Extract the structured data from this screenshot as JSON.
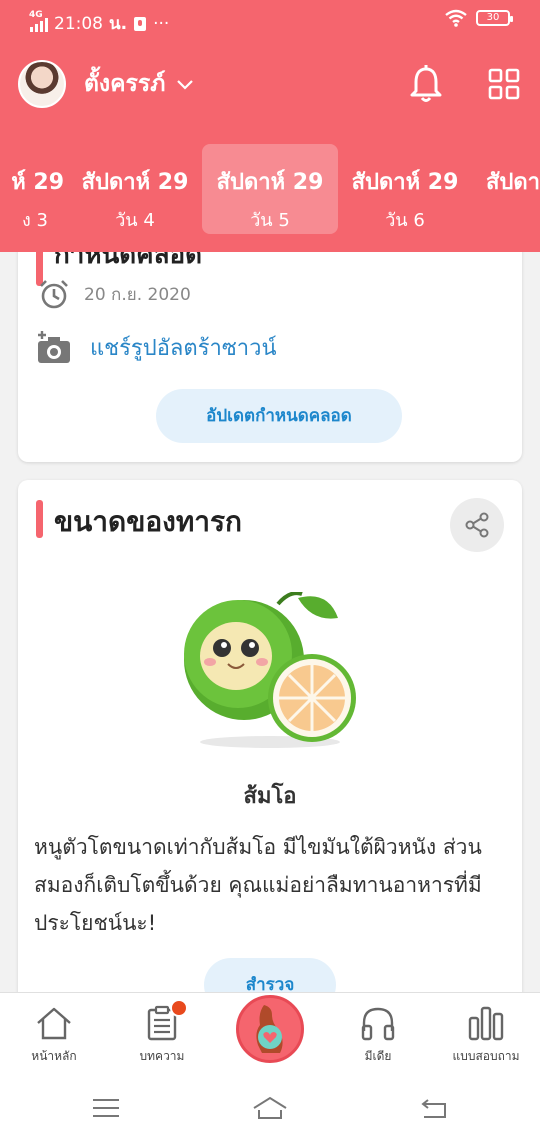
{
  "status_bar": {
    "network": "4G",
    "time": "21:08",
    "icons_text": "น.",
    "more": "···",
    "battery": "30"
  },
  "header": {
    "profile_name": "ตั้งครรภ์",
    "weeks": [
      {
        "title": "ห์ 29",
        "day": "ง 3"
      },
      {
        "title": "สัปดาห์ 29",
        "day": "วัน 4"
      },
      {
        "title": "สัปดาห์ 29",
        "day": "วัน 5"
      },
      {
        "title": "สัปดาห์ 29",
        "day": "วัน 6"
      },
      {
        "title": "สัปดา",
        "day": ""
      }
    ],
    "active_week_index": 2
  },
  "due_card": {
    "title": "กำหนดคลอด",
    "date": "20 ก.ย. 2020",
    "share_ultrasound": "แชร์รูปอัลตร้าซาวน์",
    "update_button": "อัปเดตกำหนดคลอด"
  },
  "baby_size_card": {
    "title": "ขนาดของทารก",
    "fruit_name": "ส้มโอ",
    "description": "หนูตัวโตขนาดเท่ากับส้มโอ มีไขมันใต้ผิวหนัง ส่วนสมองก็เติบโตขึ้นด้วย คุณแม่อย่าลืมทานอาหารที่มีประโยชน์นะ!",
    "explore_button": "สำรวจ"
  },
  "bottom_nav": {
    "items": [
      {
        "label": "หน้าหลัก",
        "icon": "home-icon"
      },
      {
        "label": "บทความ",
        "icon": "article-icon"
      },
      {
        "label": "",
        "icon": "pregnancy-icon"
      },
      {
        "label": "มีเดีย",
        "icon": "headphones-icon"
      },
      {
        "label": "แบบสอบถาม",
        "icon": "poll-icon"
      }
    ]
  },
  "colors": {
    "brand": "#f5656e",
    "link": "#2a86c7",
    "pill_bg": "#e4f1fb",
    "badge": "#e8491d"
  }
}
